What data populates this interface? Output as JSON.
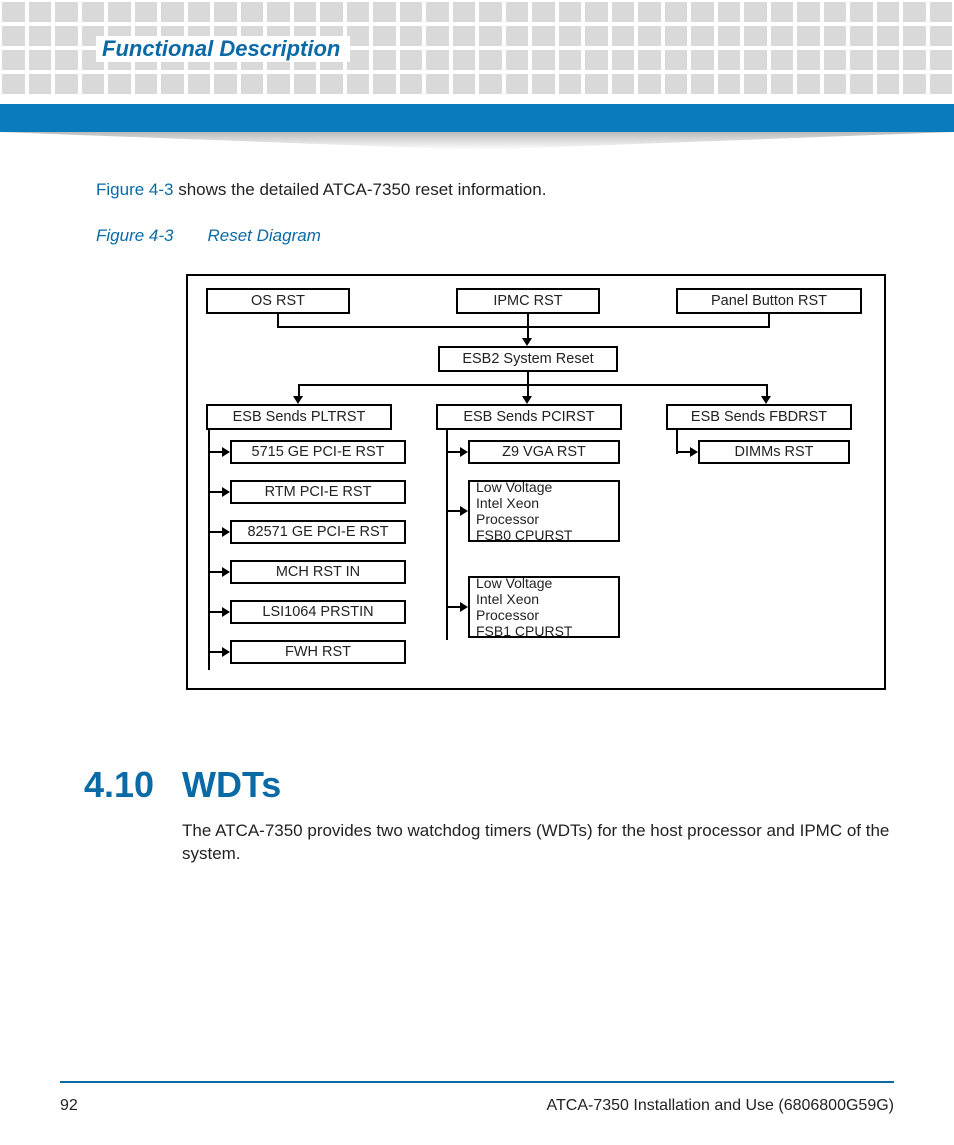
{
  "header": {
    "title": "Functional Description"
  },
  "intro": {
    "link": "Figure 4-3",
    "rest": " shows the detailed ATCA-7350 reset information."
  },
  "figure": {
    "label": "Figure 4-3",
    "title": "Reset Diagram"
  },
  "diagram": {
    "row1": {
      "os": "OS RST",
      "ipmc": "IPMC RST",
      "panel": "Panel Button RST"
    },
    "esb2": "ESB2 System Reset",
    "row3": {
      "plt": "ESB Sends PLTRST",
      "pci": "ESB Sends PCIRST",
      "fbd": "ESB Sends FBDRST"
    },
    "col_plt": {
      "a": "5715 GE PCI-E RST",
      "b": "RTM PCI-E RST",
      "c": "82571 GE PCI-E RST",
      "d": "MCH RST IN",
      "e": "LSI1064 PRSTIN",
      "f": "FWH RST"
    },
    "col_pci": {
      "a": "Z9 VGA RST",
      "b": "Low Voltage\nIntel Xeon\nProcessor\nFSB0 CPURST",
      "c": "Low Voltage\nIntel Xeon\nProcessor\nFSB1 CPURST"
    },
    "col_fbd": {
      "a": "DIMMs RST"
    }
  },
  "section": {
    "number": "4.10",
    "title": "WDTs",
    "body": "The ATCA-7350 provides two watchdog timers (WDTs) for the host processor and IPMC of the system."
  },
  "footer": {
    "page": "92",
    "doc": "ATCA-7350 Installation and Use (6806800G59G)"
  }
}
